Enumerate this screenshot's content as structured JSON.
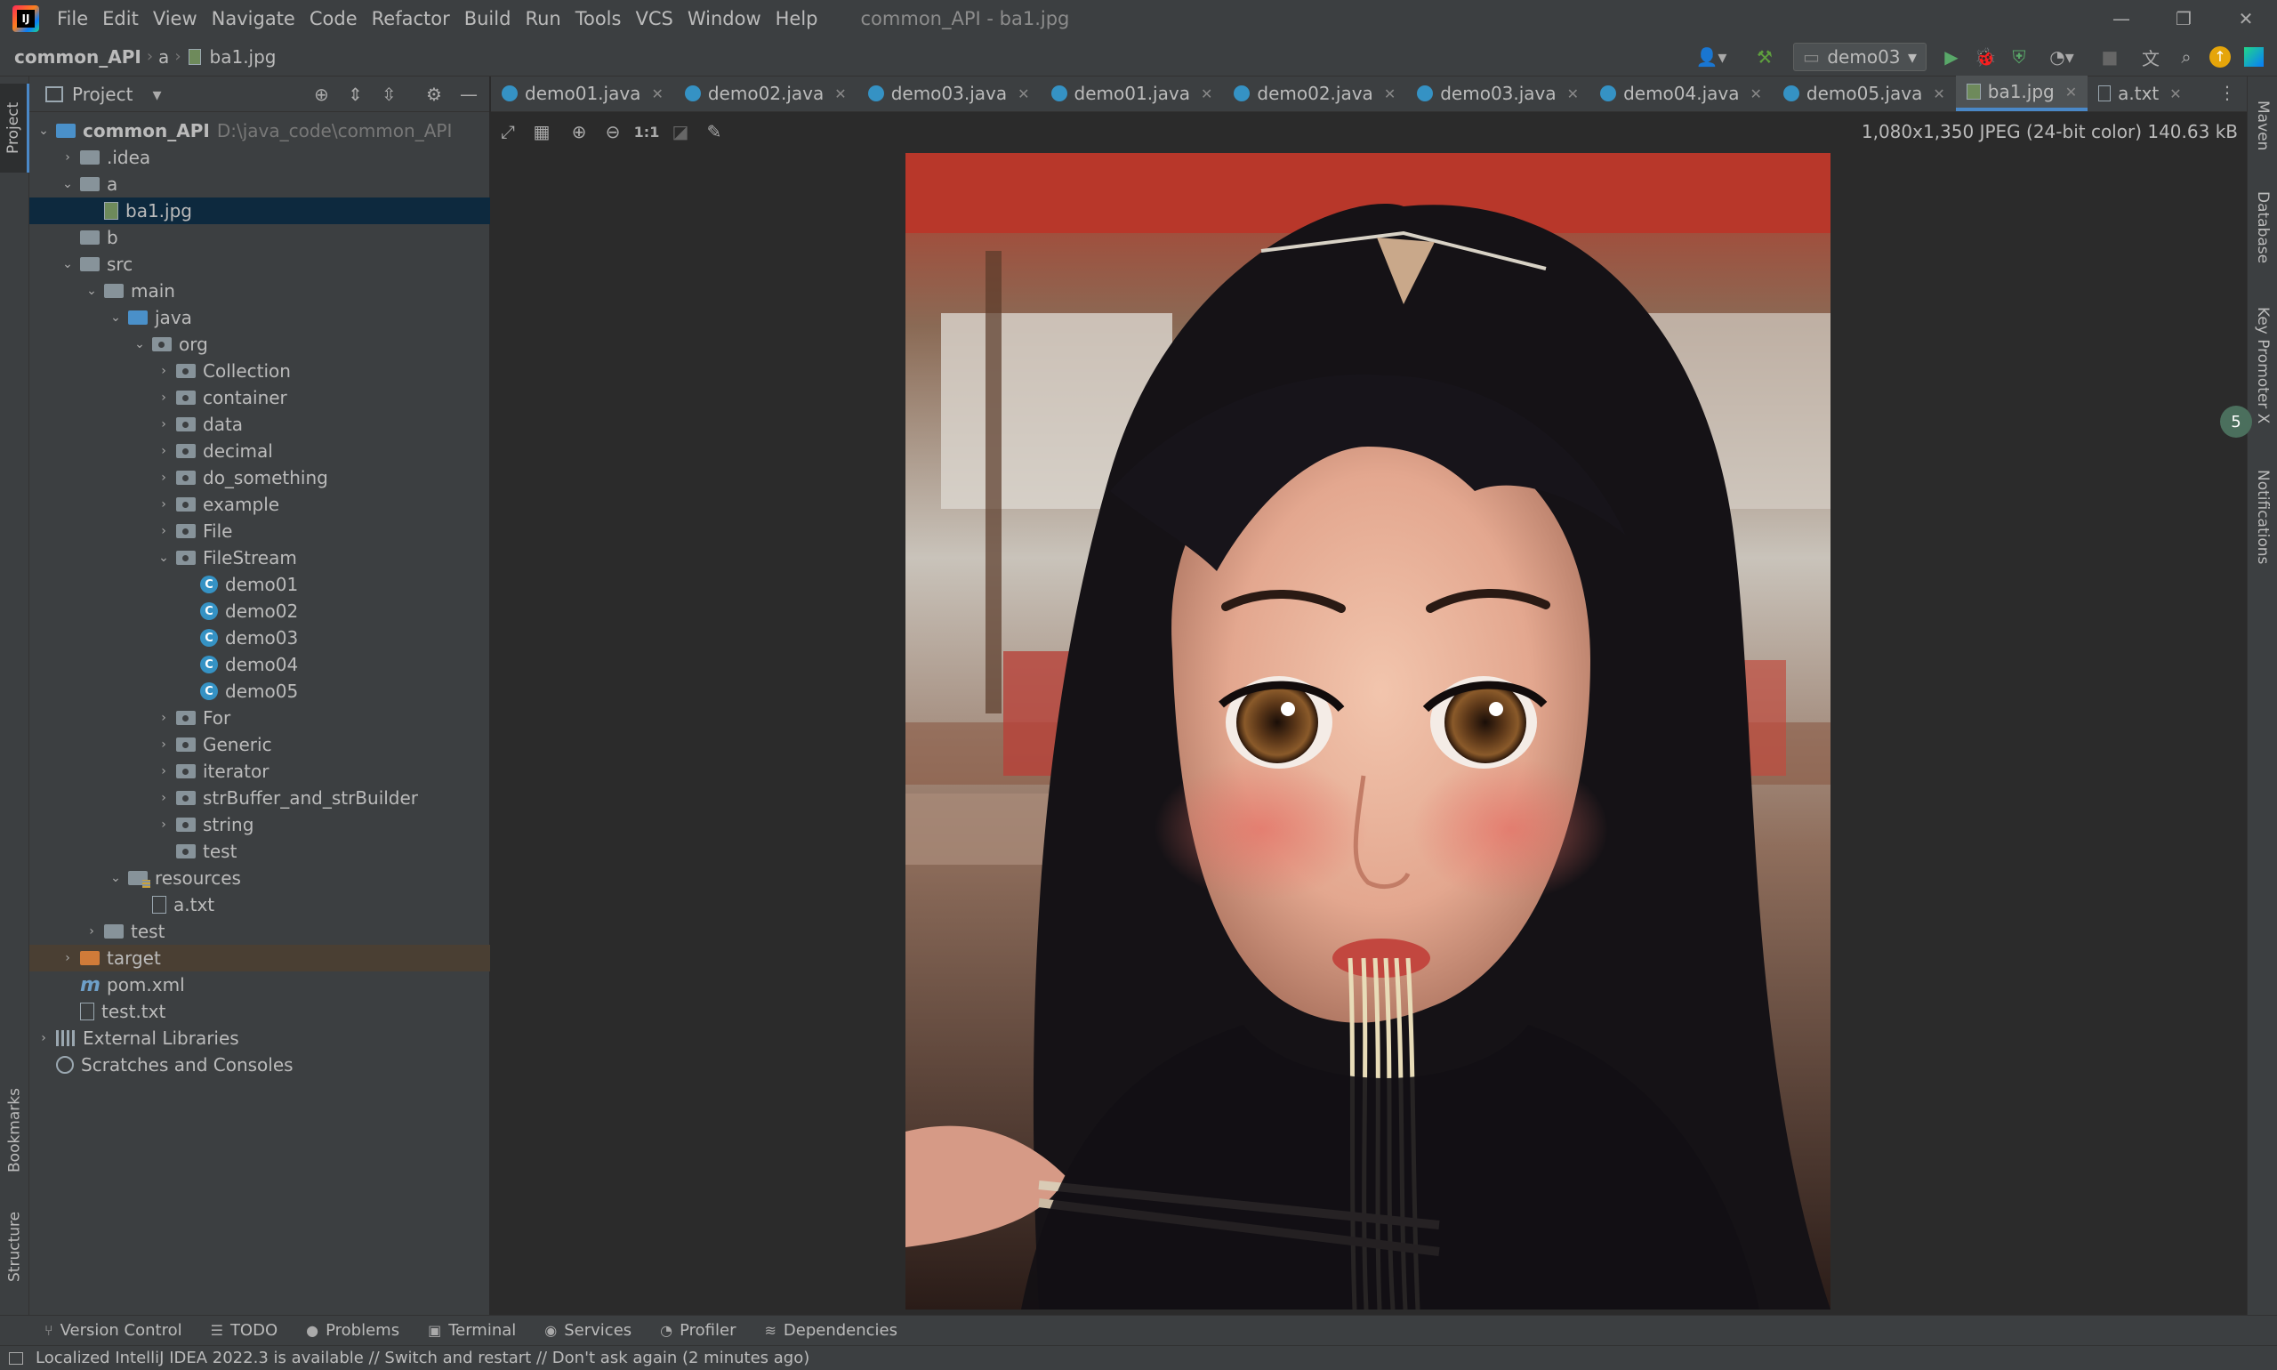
{
  "menubar": {
    "items": [
      "File",
      "Edit",
      "View",
      "Navigate",
      "Code",
      "Refactor",
      "Build",
      "Run",
      "Tools",
      "VCS",
      "Window",
      "Help"
    ],
    "title": "common_API - ba1.jpg"
  },
  "navbar": {
    "crumbs": [
      "common_API",
      "a",
      "ba1.jpg"
    ],
    "run_config": "demo03"
  },
  "project_panel": {
    "title": "Project",
    "tree": [
      {
        "label": "common_API",
        "path": "D:\\java_code\\common_API",
        "level": 0,
        "arrow": "down",
        "icon": "module-folder",
        "bold": true
      },
      {
        "label": ".idea",
        "level": 1,
        "arrow": "right",
        "icon": "folder"
      },
      {
        "label": "a",
        "level": 1,
        "arrow": "down",
        "icon": "folder"
      },
      {
        "label": "ba1.jpg",
        "level": 2,
        "arrow": "",
        "icon": "image-file",
        "selected": true
      },
      {
        "label": "b",
        "level": 1,
        "arrow": "",
        "icon": "folder"
      },
      {
        "label": "src",
        "level": 1,
        "arrow": "down",
        "icon": "folder"
      },
      {
        "label": "main",
        "level": 2,
        "arrow": "down",
        "icon": "folder"
      },
      {
        "label": "java",
        "level": 3,
        "arrow": "down",
        "icon": "source-folder"
      },
      {
        "label": "org",
        "level": 4,
        "arrow": "down",
        "icon": "package"
      },
      {
        "label": "Collection",
        "level": 5,
        "arrow": "right",
        "icon": "package"
      },
      {
        "label": "container",
        "level": 5,
        "arrow": "right",
        "icon": "package"
      },
      {
        "label": "data",
        "level": 5,
        "arrow": "right",
        "icon": "package"
      },
      {
        "label": "decimal",
        "level": 5,
        "arrow": "right",
        "icon": "package"
      },
      {
        "label": "do_something",
        "level": 5,
        "arrow": "right",
        "icon": "package"
      },
      {
        "label": "example",
        "level": 5,
        "arrow": "right",
        "icon": "package"
      },
      {
        "label": "File",
        "level": 5,
        "arrow": "right",
        "icon": "package"
      },
      {
        "label": "FileStream",
        "level": 5,
        "arrow": "down",
        "icon": "package"
      },
      {
        "label": "demo01",
        "level": 6,
        "arrow": "",
        "icon": "class"
      },
      {
        "label": "demo02",
        "level": 6,
        "arrow": "",
        "icon": "class"
      },
      {
        "label": "demo03",
        "level": 6,
        "arrow": "",
        "icon": "class"
      },
      {
        "label": "demo04",
        "level": 6,
        "arrow": "",
        "icon": "class"
      },
      {
        "label": "demo05",
        "level": 6,
        "arrow": "",
        "icon": "class"
      },
      {
        "label": "For",
        "level": 5,
        "arrow": "right",
        "icon": "package"
      },
      {
        "label": "Generic",
        "level": 5,
        "arrow": "right",
        "icon": "package"
      },
      {
        "label": "iterator",
        "level": 5,
        "arrow": "right",
        "icon": "package"
      },
      {
        "label": "strBuffer_and_strBuilder",
        "level": 5,
        "arrow": "right",
        "icon": "package"
      },
      {
        "label": "string",
        "level": 5,
        "arrow": "right",
        "icon": "package"
      },
      {
        "label": "test",
        "level": 5,
        "arrow": "",
        "icon": "package"
      },
      {
        "label": "resources",
        "level": 3,
        "arrow": "down",
        "icon": "resources-folder"
      },
      {
        "label": "a.txt",
        "level": 4,
        "arrow": "",
        "icon": "text-file"
      },
      {
        "label": "test",
        "level": 2,
        "arrow": "right",
        "icon": "folder"
      },
      {
        "label": "target",
        "level": 1,
        "arrow": "right",
        "icon": "excluded-folder",
        "highlight": true
      },
      {
        "label": "pom.xml",
        "level": 1,
        "arrow": "",
        "icon": "maven-file"
      },
      {
        "label": "test.txt",
        "level": 1,
        "arrow": "",
        "icon": "text-file"
      },
      {
        "label": "External Libraries",
        "level": 0,
        "arrow": "right",
        "icon": "libraries"
      },
      {
        "label": "Scratches and Consoles",
        "level": 0,
        "arrow": "",
        "icon": "scratches"
      }
    ]
  },
  "editor_tabs": [
    {
      "label": "demo01.java",
      "icon": "class"
    },
    {
      "label": "demo02.java",
      "icon": "class"
    },
    {
      "label": "demo03.java",
      "icon": "class"
    },
    {
      "label": "demo01.java",
      "icon": "class"
    },
    {
      "label": "demo02.java",
      "icon": "class"
    },
    {
      "label": "demo03.java",
      "icon": "class"
    },
    {
      "label": "demo04.java",
      "icon": "class"
    },
    {
      "label": "demo05.java",
      "icon": "class"
    },
    {
      "label": "ba1.jpg",
      "icon": "image",
      "active": true
    },
    {
      "label": "a.txt",
      "icon": "text"
    }
  ],
  "image_viewer": {
    "info": "1,080x1,350 JPEG (24-bit color) 140.63 kB",
    "actual_size_label": "1:1"
  },
  "left_strip": {
    "project": "Project",
    "bookmarks": "Bookmarks",
    "structure": "Structure"
  },
  "right_strip": {
    "maven": "Maven",
    "database": "Database",
    "key_promoter": "Key Promoter X",
    "notifications": "Notifications",
    "badge": "5"
  },
  "tool_windows": [
    "Version Control",
    "TODO",
    "Problems",
    "Terminal",
    "Services",
    "Profiler",
    "Dependencies"
  ],
  "status": {
    "message": "Localized IntelliJ IDEA 2022.3 is available // Switch and restart // Don't ask again (2 minutes ago)"
  },
  "colors": {
    "accent": "#4a88c7",
    "selection": "#0d293e",
    "panel": "#3c3f41",
    "editor": "#2b2b2b"
  }
}
